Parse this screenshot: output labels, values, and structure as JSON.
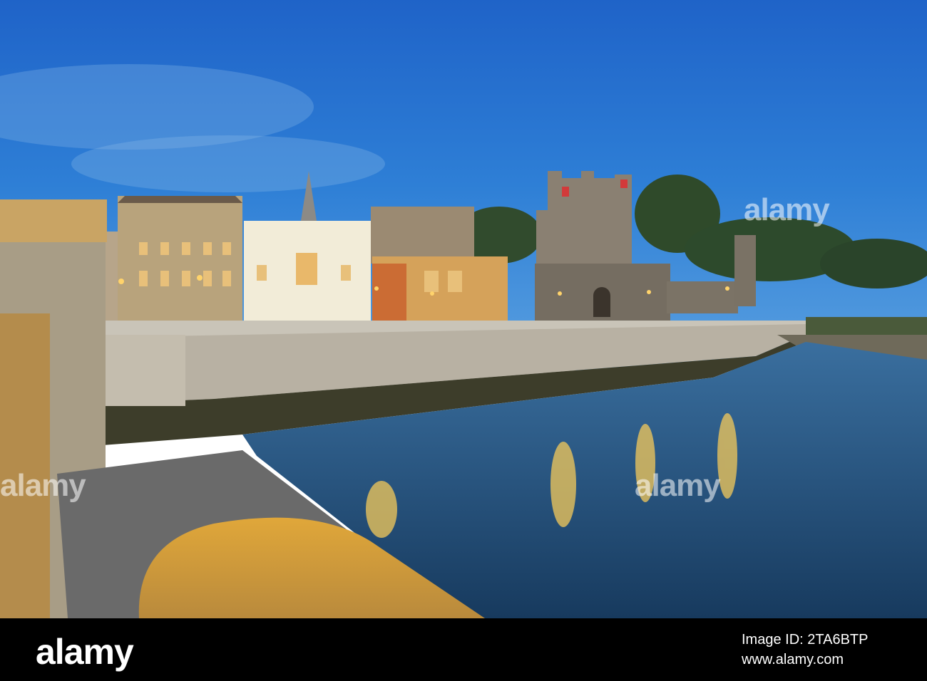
{
  "watermark": {
    "text": "alamy"
  },
  "footer": {
    "brand": "alamy",
    "image_id_label": "Image ID: 2TA6BTP",
    "site": "www.alamy.com"
  }
}
